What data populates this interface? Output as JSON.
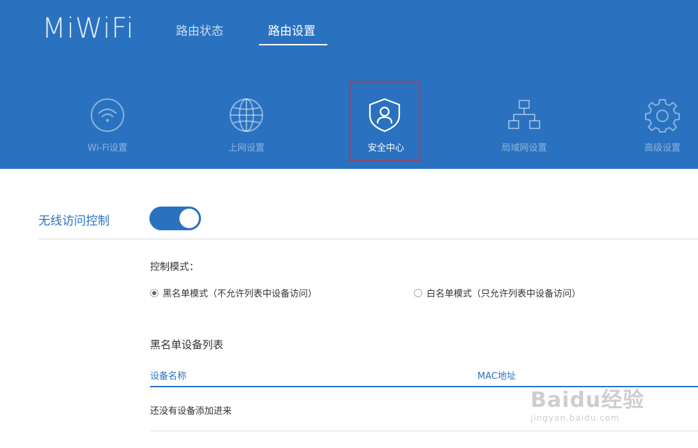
{
  "header": {
    "logo": "MiWiFi",
    "tabs": [
      {
        "label": "路由状态",
        "active": false
      },
      {
        "label": "路由设置",
        "active": true
      }
    ]
  },
  "categories": [
    {
      "label": "Wi-Fi设置",
      "icon": "wifi-icon"
    },
    {
      "label": "上网设置",
      "icon": "globe-icon"
    },
    {
      "label": "安全中心",
      "icon": "shield-user-icon",
      "active": true
    },
    {
      "label": "局域网设置",
      "icon": "lan-network-icon"
    },
    {
      "label": "高级设置",
      "icon": "gear-icon"
    }
  ],
  "wireless_access": {
    "title": "无线访问控制",
    "enabled": true
  },
  "control_mode": {
    "label": "控制模式：",
    "options": [
      {
        "label": "黑名单模式（不允许列表中设备访问）",
        "checked": true
      },
      {
        "label": "白名单模式（只允许列表中设备访问）",
        "checked": false
      }
    ]
  },
  "device_list": {
    "title": "黑名单设备列表",
    "columns": [
      "设备名称",
      "MAC地址"
    ],
    "empty_text": "还没有设备添加进来"
  },
  "watermark": {
    "line1": "Baidu经验",
    "line2": "jingyan.baidu.com"
  },
  "colors": {
    "primary": "#2a72c0",
    "highlight_border": "#e02a2a"
  }
}
